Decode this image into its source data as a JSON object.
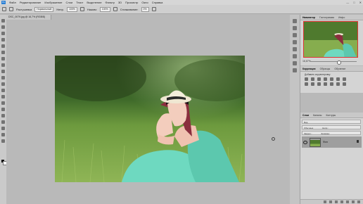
{
  "menubar": {
    "logo": "Ps",
    "items": [
      "Файл",
      "Редактирование",
      "Изображение",
      "Слои",
      "Текст",
      "Выделение",
      "Фильтр",
      "3D",
      "Просмотр",
      "Окно",
      "Справка"
    ],
    "window_controls": [
      "—",
      "□",
      "✕"
    ]
  },
  "options_bar": {
    "feather_label": "Растушевка",
    "mode_value": "Нормальный",
    "opacity_label": "Непр.",
    "opacity_value": "100%",
    "flow_label": "Нажим:",
    "flow_value": "100%",
    "smoothing_label": "Сглаживание:",
    "smoothing_value": "0%"
  },
  "document": {
    "tab_title": "DSC_0079.jpg @ 16,7% (RGB/8)"
  },
  "panels": {
    "navigator": {
      "tabs": [
        "Навигатор",
        "Гистограмма",
        "Инфо"
      ],
      "zoom": "16,67%",
      "zoom_fraction": 0.6
    },
    "adjustments": {
      "tabs": [
        "Коррекция",
        "Образцы",
        "Обучение"
      ],
      "subtitle": "Добавить корректировку"
    },
    "layers": {
      "tabs": [
        "Слои",
        "Каналы",
        "Контуры"
      ],
      "kind_label": "Вид",
      "blend_mode": "Обычные",
      "opacity_label": "Непр.:",
      "lock_label": "Закреп.:",
      "fill_label": "Заливка:",
      "layer_name": "Фон"
    }
  },
  "icons": {
    "tools": [
      "move-icon",
      "marquee-icon",
      "lasso-icon",
      "quick-select-icon",
      "crop-icon",
      "eyedropper-icon",
      "healing-brush-icon",
      "brush-icon",
      "clone-stamp-icon",
      "history-brush-icon",
      "eraser-icon",
      "gradient-icon",
      "blur-icon",
      "dodge-icon",
      "pen-icon",
      "type-icon",
      "path-select-icon",
      "shape-icon",
      "hand-icon",
      "zoom-icon"
    ],
    "right_strip": [
      "history-icon",
      "properties-icon",
      "brush-settings-icon",
      "character-icon",
      "paragraph-icon",
      "glyphs-icon",
      "channels-icon",
      "libraries-icon"
    ]
  }
}
